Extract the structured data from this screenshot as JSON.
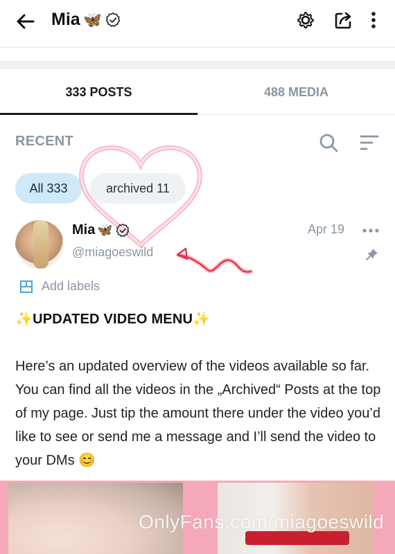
{
  "header": {
    "title": "Mia",
    "butterfly": "🦋",
    "icons": [
      "back-arrow-icon",
      "verified-icon",
      "settings-gear-icon",
      "share-icon",
      "more-vertical-icon"
    ]
  },
  "tabs": [
    {
      "label": "333 POSTS",
      "active": true
    },
    {
      "label": "488 MEDIA",
      "active": false
    }
  ],
  "section": {
    "title": "RECENT"
  },
  "filters": [
    {
      "label": "All 333",
      "selected": true
    },
    {
      "label": "archived 11",
      "selected": false
    }
  ],
  "post": {
    "author": "Mia",
    "butterfly": "🦋",
    "handle": "@miagoeswild",
    "date": "Apr 19",
    "add_labels": "Add labels",
    "title_sparkle": "✨",
    "title": "UPDATED VIDEO MENU",
    "body": "Here’s an updated overview of the videos available so far. You can find all the videos in the „Archived“ Posts at the top of my page. Just tip the amount there un­der the video you’d like to see or send me a message and I’ll send the video to your DMs 😊"
  },
  "media": {
    "watermark": "OnlyFans.com/miagoeswild"
  },
  "colors": {
    "accent_blue": "#cfe9f9",
    "muted_gray": "#8a96a3",
    "doodle_red": "#e8344c",
    "media_pink": "#f5a9b8"
  }
}
